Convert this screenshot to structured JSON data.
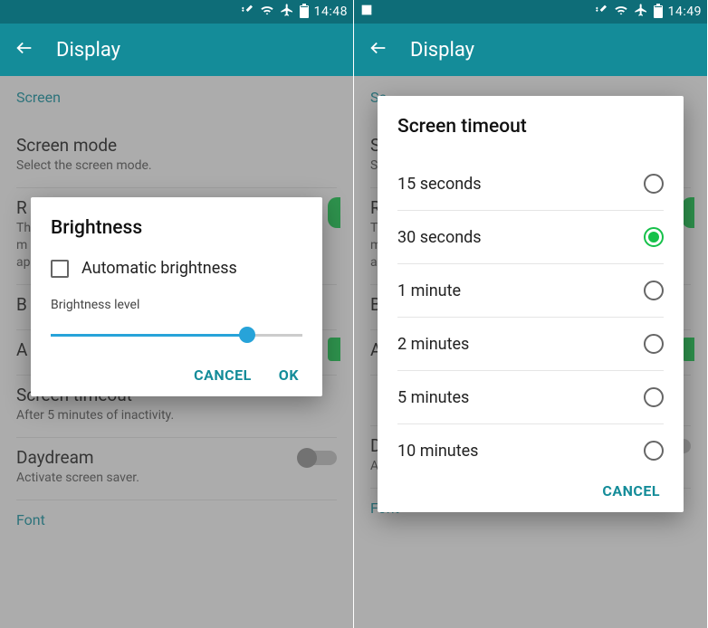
{
  "left": {
    "status_time": "14:48",
    "app_title": "Display",
    "section": "Screen",
    "rows": {
      "screen_mode_title": "Screen mode",
      "screen_mode_sub": "Select the screen mode.",
      "r_title": "R",
      "r_sub1": "Th",
      "r_sub2": "m",
      "r_sub3": "ap",
      "b_title": "B",
      "a_title": "A",
      "timeout_title": "Screen timeout",
      "timeout_sub": "After 5 minutes of inactivity.",
      "daydream_title": "Daydream",
      "daydream_sub": "Activate screen saver.",
      "font_section": "Font"
    },
    "dialog": {
      "title": "Brightness",
      "auto_label": "Automatic brightness",
      "level_label": "Brightness level",
      "slider_pct": 78,
      "cancel": "CANCEL",
      "ok": "OK"
    }
  },
  "right": {
    "status_time": "14:49",
    "app_title": "Display",
    "section": "Sc",
    "rows": {
      "sc_title": "Sc",
      "sc_sub": "Se",
      "r_title": "R",
      "r_sub1": "Th",
      "r_sub2": "m",
      "r_sub3": "ap",
      "b_title": "B",
      "a_title": "A",
      "d_title": "D",
      "d_sub": "Activate screen saver.",
      "font_section": "Font"
    },
    "dialog": {
      "title": "Screen timeout",
      "options": [
        {
          "label": "15 seconds",
          "selected": false
        },
        {
          "label": "30 seconds",
          "selected": true
        },
        {
          "label": "1 minute",
          "selected": false
        },
        {
          "label": "2 minutes",
          "selected": false
        },
        {
          "label": "5 minutes",
          "selected": false
        },
        {
          "label": "10 minutes",
          "selected": false
        }
      ],
      "cancel": "CANCEL"
    }
  }
}
